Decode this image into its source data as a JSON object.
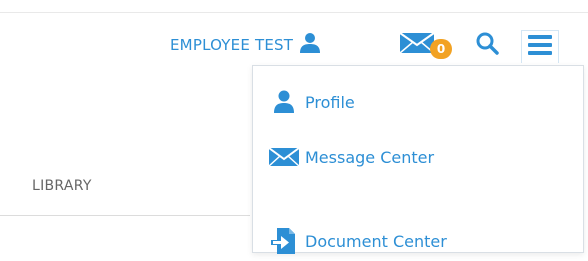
{
  "header": {
    "username": "EMPLOYEE TEST",
    "user_icon": "user-icon",
    "mail_icon": "envelope-icon",
    "mail_count": "0",
    "search_icon": "search-icon",
    "menu_icon": "hamburger-menu-icon"
  },
  "dropdown": {
    "items": [
      {
        "label": "Profile",
        "icon": "user-icon"
      },
      {
        "label": "Message Center",
        "icon": "envelope-icon"
      },
      {
        "label": "Document Center",
        "icon": "document-arrow-icon"
      }
    ]
  },
  "nav": {
    "library_label": "LIBRARY"
  },
  "colors": {
    "accent": "#2d8fd5",
    "badge": "#f2a223",
    "muted_text": "#666666"
  }
}
